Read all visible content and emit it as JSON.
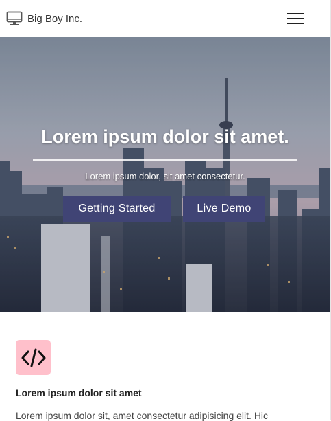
{
  "header": {
    "brand_name": "Big Boy Inc.",
    "brand_icon": "desktop-monitor-icon",
    "menu_icon": "hamburger-menu-icon"
  },
  "hero": {
    "title": "Lorem ipsum dolor sit amet.",
    "subtitle": "Lorem ipsum dolor, sit amet consectetur.",
    "primary_button": "Getting Started",
    "secondary_button": "Live Demo",
    "button_color": "#404475"
  },
  "feature": {
    "icon": "code-icon",
    "icon_bg": "#ffc0cb",
    "title": "Lorem ipsum dolor sit amet",
    "text": "Lorem ipsum dolor sit, amet consectetur adipisicing elit. Hic"
  }
}
